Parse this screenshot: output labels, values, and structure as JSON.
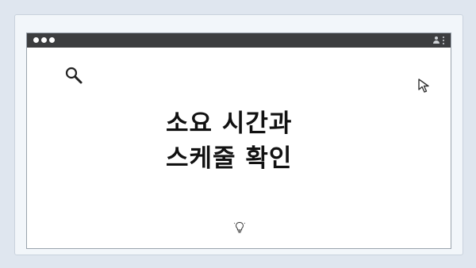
{
  "window": {
    "headline_line1": "소요 시간과",
    "headline_line2": "스케줄 확인"
  },
  "icons": {
    "search": "search-icon",
    "cursor": "cursor-icon",
    "bulb": "lightbulb-icon",
    "avatar": "avatar-icon",
    "menu": "more-vertical-icon"
  },
  "colors": {
    "background": "#dfe6ef",
    "titlebar": "#3c3d3f",
    "text": "#111111"
  }
}
